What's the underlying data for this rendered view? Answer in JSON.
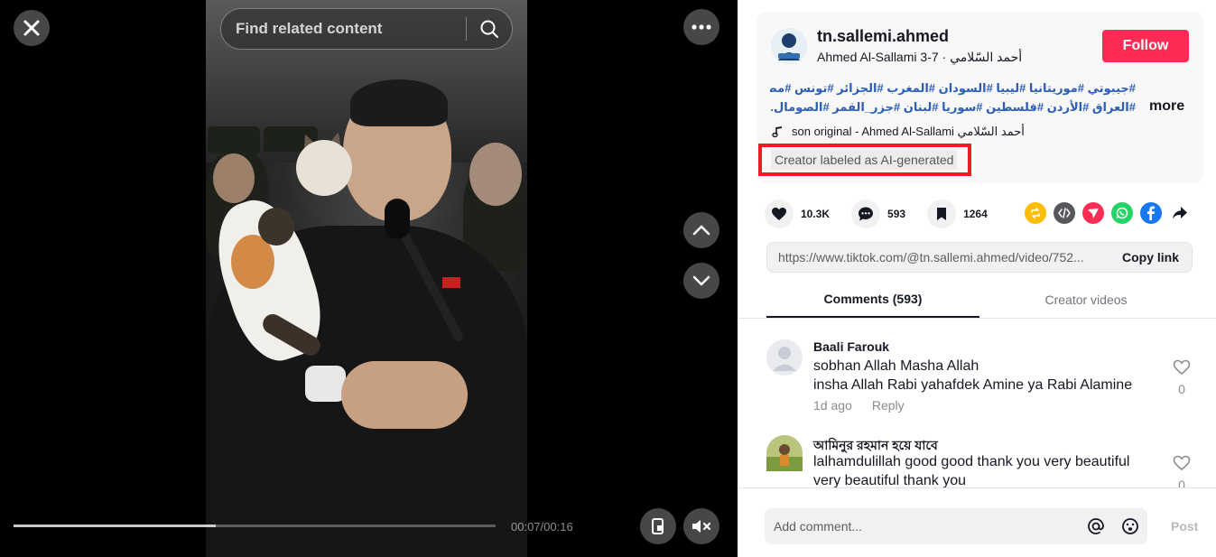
{
  "video": {
    "search_placeholder": "Find related content",
    "time": "00:07/00:16",
    "progress": 0.42
  },
  "creator": {
    "username": "tn.sallemi.ahmed",
    "display_name": "Ahmed Al-Sallami أحمد السّلامي",
    "date": "7-3",
    "separator": " · ",
    "follow_label": "Follow"
  },
  "caption": {
    "hashtags_line1": "#جيبوتي #موريتانيا #ليبيا #السودان #المغرب #الجزائر #تونس #مصر #ا",
    "hashtags_line2": "#العراق #الأردن #فلسطين #سوريا #لبنان #جزر_القمر #الصومال...",
    "more_label": "more",
    "music": "son original - Ahmed Al-Sallami أحمد السّلامي",
    "ai_label": "Creator labeled as AI-generated"
  },
  "actions": {
    "likes": "10.3K",
    "comments": "593",
    "saves": "1264"
  },
  "share": {
    "link": "https://www.tiktok.com/@tn.sallemi.ahmed/video/752...",
    "copy_label": "Copy link"
  },
  "tabs": {
    "comments": "Comments (593)",
    "creator_videos": "Creator videos"
  },
  "comments": [
    {
      "user": "Baali Farouk",
      "line1": "sobhan Allah Masha Allah",
      "line2": "insha Allah Rabi yahafdek Amine ya Rabi Alamine",
      "time": "1d ago",
      "reply": "Reply",
      "likes": "0"
    },
    {
      "user": "আমিনুর রহমান হয়ে যাবে",
      "line1": "lalhamdulillah good good thank you very beautiful",
      "line2": "very beautiful thank you",
      "likes": "0"
    }
  ],
  "composer": {
    "placeholder": "Add comment...",
    "post_label": "Post"
  },
  "colors": {
    "follow": "#fe2c55",
    "hashtag": "#2b5db9",
    "highlight": "#ec1c24"
  }
}
